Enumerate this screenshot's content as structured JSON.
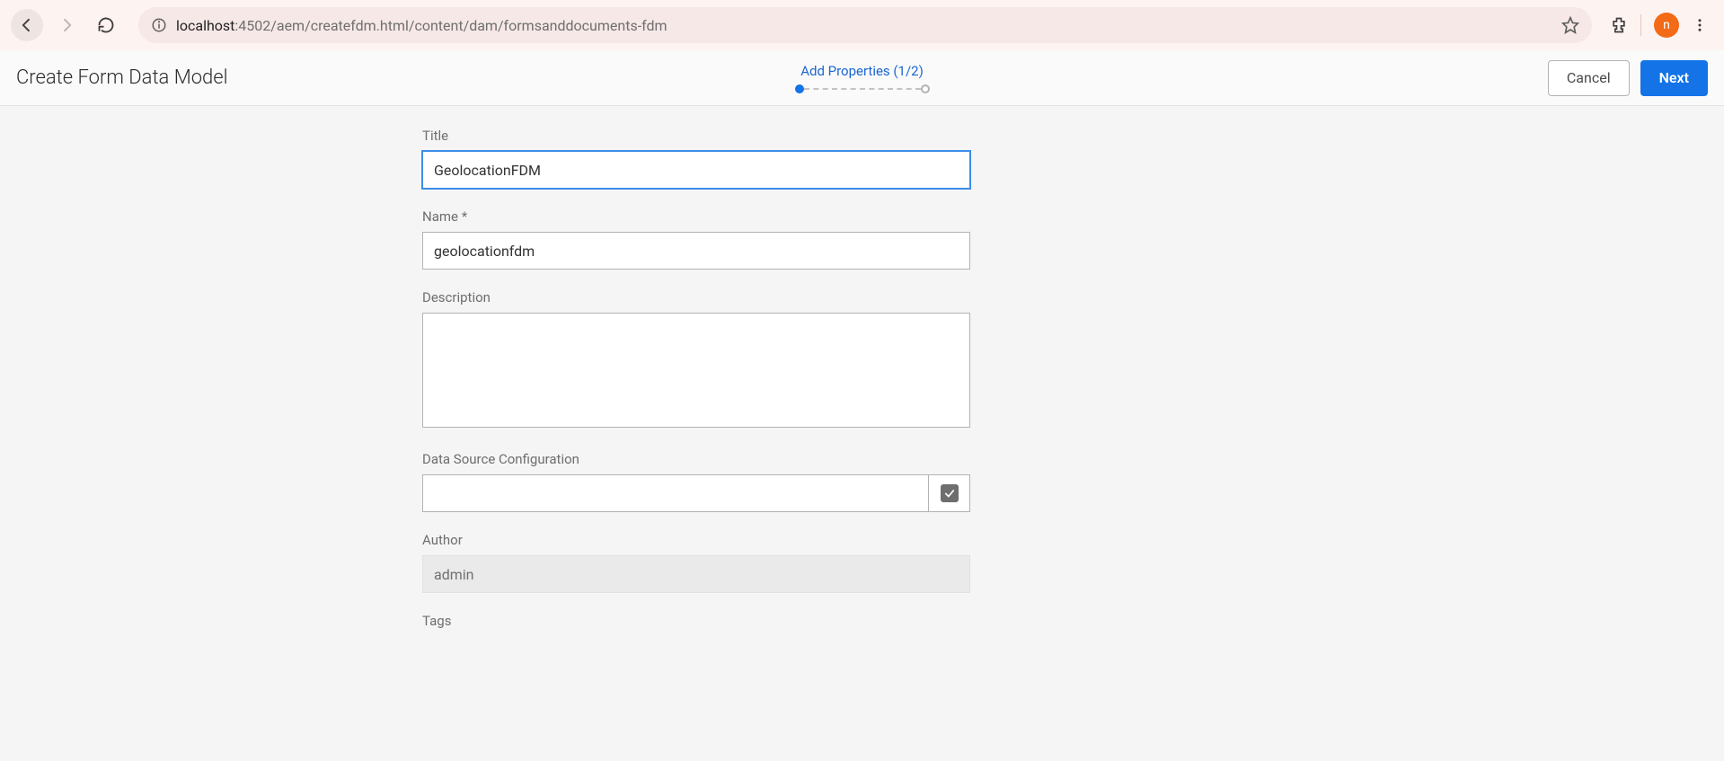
{
  "browser": {
    "url_host": "localhost",
    "url_rest": ":4502/aem/createfdm.html/content/dam/formsanddocuments-fdm",
    "avatar_letter": "n"
  },
  "header": {
    "title": "Create Form Data Model",
    "stepper_label": "Add Properties (1/2)",
    "cancel_label": "Cancel",
    "next_label": "Next"
  },
  "form": {
    "title": {
      "label": "Title",
      "value": "GeolocationFDM"
    },
    "name": {
      "label": "Name *",
      "value": "geolocationfdm"
    },
    "description": {
      "label": "Description",
      "value": ""
    },
    "dsconfig": {
      "label": "Data Source Configuration",
      "value": ""
    },
    "author": {
      "label": "Author",
      "value": "admin"
    },
    "tags": {
      "label": "Tags"
    }
  }
}
